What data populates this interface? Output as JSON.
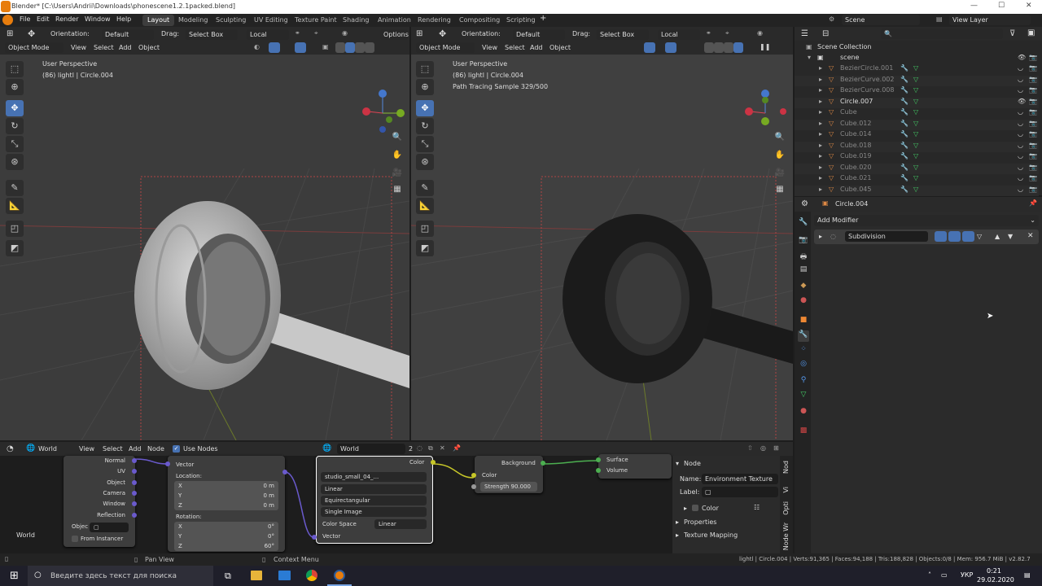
{
  "window": {
    "title": "Blender* [C:\\Users\\Andrii\\Downloads\\phonescene1.2.1packed.blend]"
  },
  "menu": [
    "File",
    "Edit",
    "Render",
    "Window",
    "Help"
  ],
  "workspaces": [
    "Layout",
    "Modeling",
    "Sculpting",
    "UV Editing",
    "Texture Paint",
    "Shading",
    "Animation",
    "Rendering",
    "Compositing",
    "Scripting"
  ],
  "scene": {
    "name": "Scene",
    "view_layer": "View Layer"
  },
  "viewport_header": {
    "orientation_label": "Orientation:",
    "orientation_value": "Default",
    "drag_label": "Drag:",
    "drag_value": "Select Box",
    "transform": "Local",
    "options": "Options",
    "mode": "Object Mode",
    "menus": [
      "View",
      "Select",
      "Add",
      "Object"
    ]
  },
  "viewport_left": {
    "perspective": "User Perspective",
    "object_info": "(86) lightl | Circle.004"
  },
  "viewport_right": {
    "perspective": "User Perspective",
    "object_info": "(86) lightl | Circle.004",
    "render_status": "Path Tracing Sample 329/500"
  },
  "outliner": {
    "collection": "Scene Collection",
    "scene_row": "scene",
    "items": [
      "BezierCircle.001",
      "BezierCurve.002",
      "BezierCurve.008",
      "Circle.007",
      "Cube",
      "Cube.012",
      "Cube.014",
      "Cube.018",
      "Cube.019",
      "Cube.020",
      "Cube.021",
      "Cube.045"
    ]
  },
  "properties": {
    "object_name": "Circle.004",
    "add_modifier": "Add Modifier",
    "modifier_name": "Subdivision"
  },
  "node_editor": {
    "type": "World",
    "menus": [
      "View",
      "Select",
      "Add",
      "Node"
    ],
    "use_nodes": "Use Nodes",
    "world_name": "World",
    "users": "2",
    "corner_label": "World",
    "tex_coord": {
      "outputs": [
        "Normal",
        "UV",
        "Object",
        "Camera",
        "Window",
        "Reflection"
      ],
      "object_label": "Objec",
      "from_instancer": "From Instancer"
    },
    "mapping": {
      "vector": "Vector",
      "location": "Location:",
      "rotation": "Rotation:",
      "loc": [
        {
          "axis": "X",
          "value": "0 m"
        },
        {
          "axis": "Y",
          "value": "0 m"
        },
        {
          "axis": "Z",
          "value": "0 m"
        }
      ],
      "rot": [
        {
          "axis": "X",
          "value": "0°"
        },
        {
          "axis": "Y",
          "value": "0°"
        },
        {
          "axis": "Z",
          "value": "60°"
        }
      ]
    },
    "env_tex": {
      "image": "studio_small_04_...",
      "interp": "Linear",
      "projection": "Equirectangular",
      "source": "Single Image",
      "color_space_label": "Color Space",
      "color_space": "Linear",
      "vector": "Vector",
      "color_out": "Color"
    },
    "background": {
      "title": "Background",
      "color": "Color",
      "strength": "Strength",
      "strength_value": "90.000"
    },
    "output": {
      "surface": "Surface",
      "volume": "Volume"
    },
    "sidebar": {
      "section": "Node",
      "name_label": "Name:",
      "name_value": "Environment Texture",
      "label_label": "Label:",
      "color": "Color",
      "properties": "Properties",
      "texture_mapping": "Texture Mapping",
      "tabs": [
        "Node",
        "Opti",
        "Vi",
        "Node Wr"
      ]
    }
  },
  "statusbar": {
    "pan": "Pan View",
    "context": "Context Menu",
    "stats": "lightl | Circle.004 | Verts:91,365 | Faces:94,188 | Tris:188,828 | Objects:0/8 | Mem: 956.7 MiB | v2.82.7"
  },
  "taskbar": {
    "search": "Введите здесь текст для поиска",
    "lang": "УКР",
    "time": "0:21",
    "date": "29.02.2020"
  }
}
